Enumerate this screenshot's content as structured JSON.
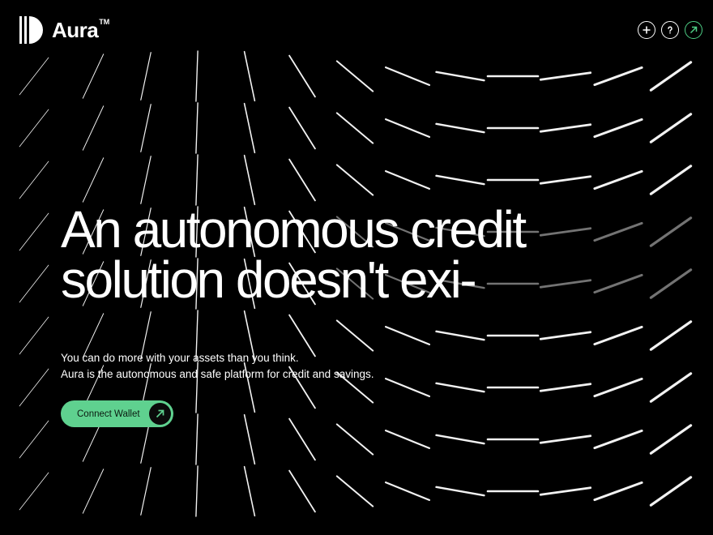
{
  "brand": {
    "name": "Aura",
    "tm": "TM"
  },
  "header": {
    "actions": [
      {
        "icon": "plus-icon",
        "label": "+"
      },
      {
        "icon": "help-icon",
        "label": "?"
      },
      {
        "icon": "arrow-up-right-icon",
        "label": ""
      }
    ]
  },
  "hero": {
    "headline_line1": "An autonomous credit",
    "headline_line2": "solution doesn't exi-",
    "sub_line1": "You can do more with your assets than you think.",
    "sub_line2": "Aura is the autonomous and safe platform for credit and savings.",
    "cta_label": "Connect Wallet"
  },
  "colors": {
    "accent": "#5fd18f",
    "background": "#000000",
    "text": "#ffffff"
  }
}
